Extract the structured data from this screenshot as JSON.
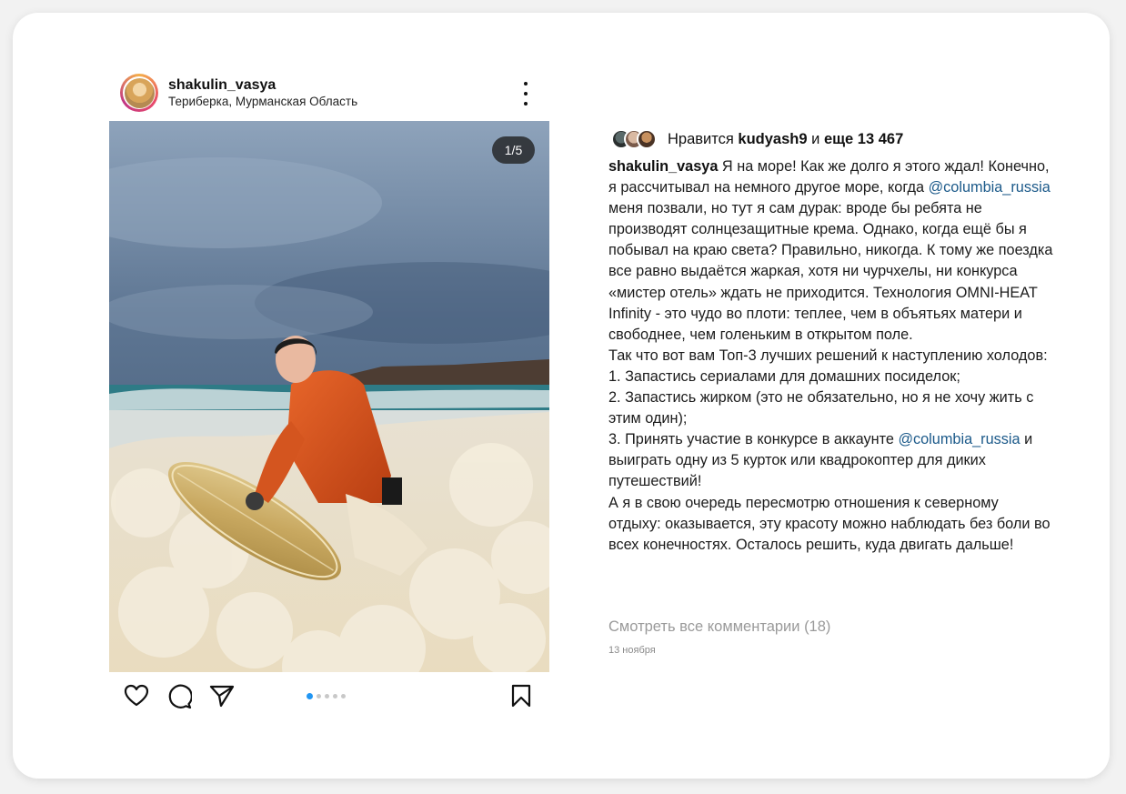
{
  "post": {
    "username": "shakulin_vasya",
    "location": "Териберка, Мурманская Область",
    "image_counter": "1/5",
    "carousel": {
      "total": 5,
      "active_index": 0
    }
  },
  "likes": {
    "prefix": "Нравится",
    "liked_by": "kudyash9",
    "and": "и",
    "others": "еще 13 467"
  },
  "caption": {
    "username": "shakulin_vasya",
    "segments": [
      {
        "type": "text",
        "text": "Я на море! Как же долго я этого ждал! Конечно, я рассчитывал на немного другое море, когда "
      },
      {
        "type": "mention",
        "text": "@columbia_russia"
      },
      {
        "type": "text",
        "text": " меня позвали, но тут я сам дурак: вроде бы ребята не производят солнцезащитные крема. Однако, когда ещё бы я побывал на краю света? Правильно, никогда. К тому же поездка все равно выдаётся жаркая, хотя ни чурчхелы, ни конкурса «мистер отель» ждать не приходится. Технология OMNI-HEAT Infinity - это чудо во плоти: теплее, чем в объятьях матери и свободнее, чем голеньким в открытом поле."
      },
      {
        "type": "text",
        "text": "Так что вот вам Топ-3 лучших решений к наступлению холодов:"
      },
      {
        "type": "text",
        "text": " 1. Запастись сериалами для домашних посиделок;"
      },
      {
        "type": "text",
        "text": " 2. Запастись жирком (это не обязательно, но я не хочу жить с этим один);"
      },
      {
        "type": "text",
        "text": " 3. Принять участие в конкурсе в аккаунте "
      },
      {
        "type": "mention",
        "text": "@columbia_russia"
      },
      {
        "type": "text",
        "text": " и выиграть одну из 5 курток или квадрокоптер для диких путешествий!"
      },
      {
        "type": "text",
        "text": "А я в свою очередь пересмотрю отношения к северному отдыху: оказывается, эту красоту можно наблюдать без боли во всех конечностях. Осталось решить, куда двигать дальше!"
      }
    ]
  },
  "comments": {
    "view_all": "Смотреть все комментарии (18)"
  },
  "date": "13 ноября",
  "icons": {
    "like": "heart-icon",
    "comment": "comment-icon",
    "share": "send-icon",
    "save": "bookmark-icon",
    "more": "more-vertical-icon"
  },
  "colors": {
    "mention": "#1c5a8a",
    "carousel_active": "#2196f3",
    "muted_text": "#9a9a9a"
  }
}
